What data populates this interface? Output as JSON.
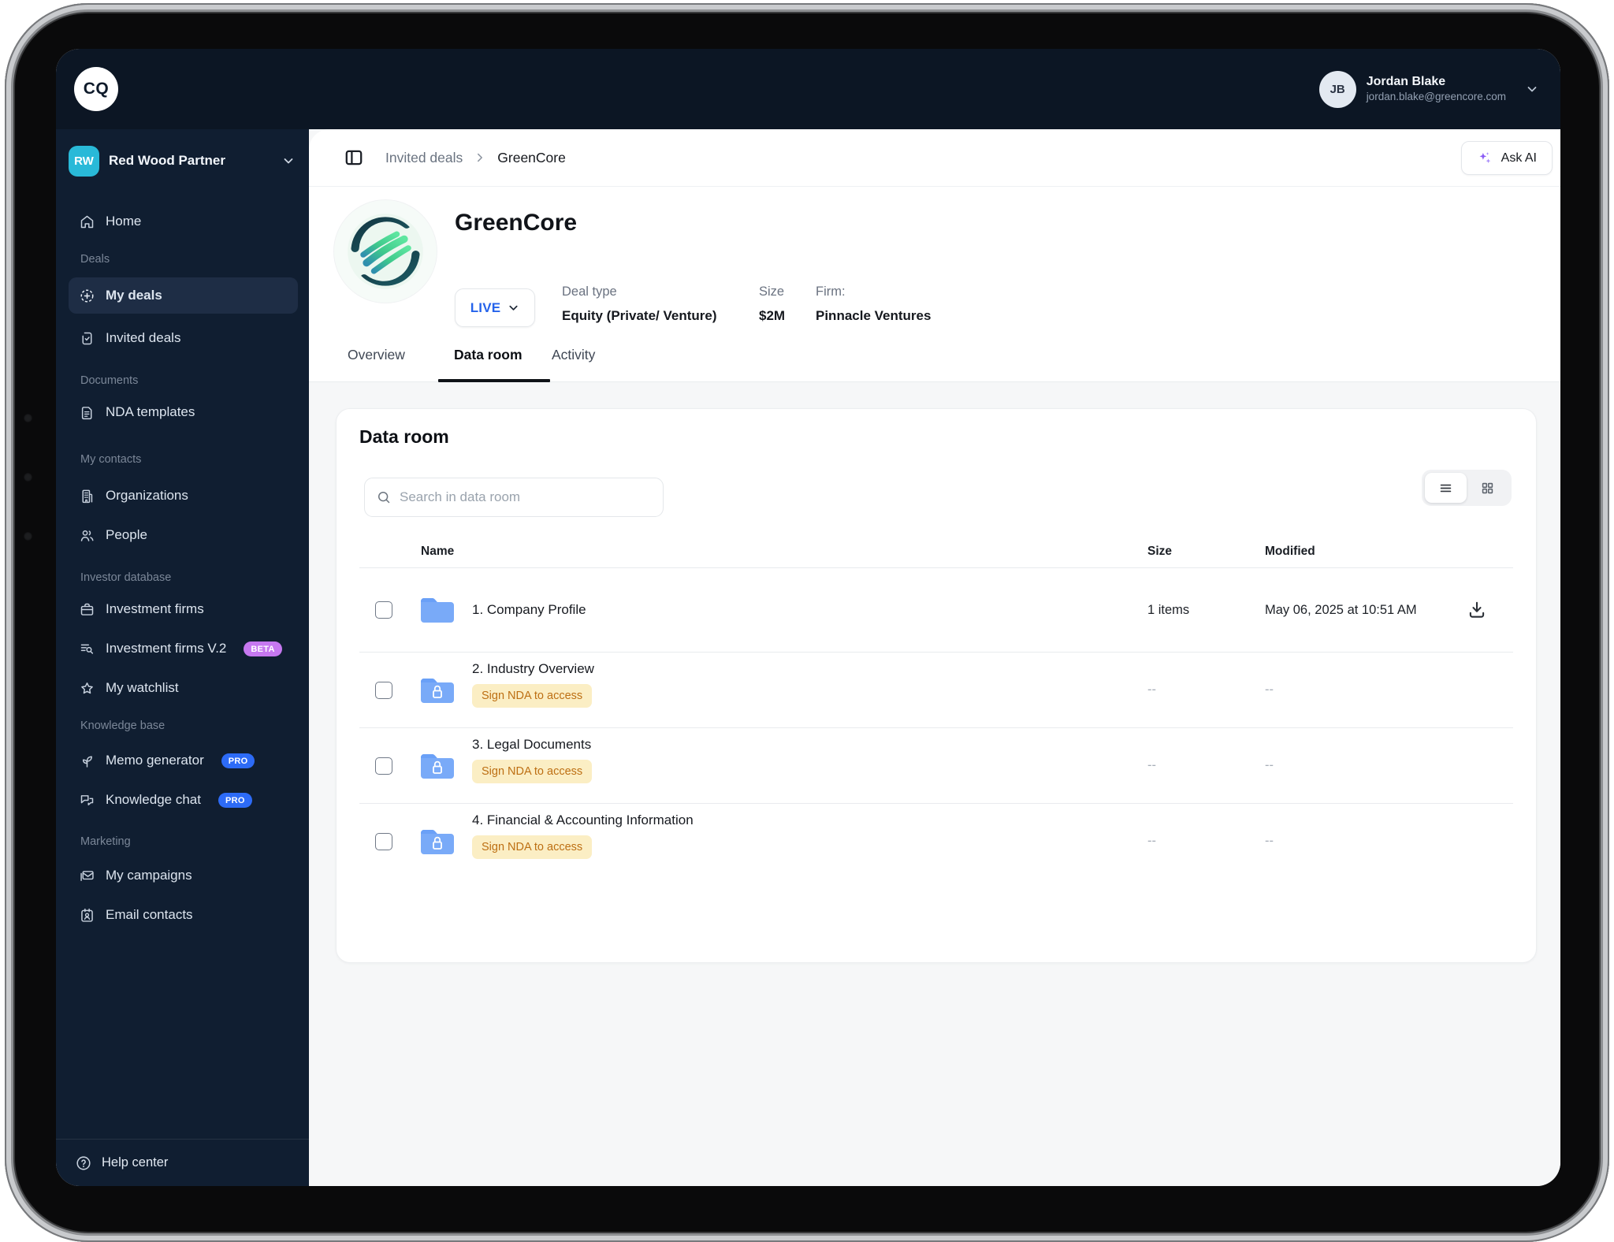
{
  "colors": {
    "topbar_bg": "#0c1624",
    "sidebar_bg": "#101e31",
    "workspace_badge": "#29b9d8",
    "beta_badge": "#c678f0",
    "pro_badge": "#2d6bf6",
    "live_blue": "#2563eb",
    "ai_sparkle": "#8b5cf6",
    "folder_blue": "#79aaf8",
    "nda_badge_bg": "#fbeec4",
    "nda_badge_text": "#bd6f13"
  },
  "topbar": {
    "logo_text": "CQ",
    "user": {
      "initials": "JB",
      "name": "Jordan Blake",
      "email": "jordan.blake@greencore.com"
    }
  },
  "sidebar": {
    "workspace": {
      "initials": "RW",
      "name": "Red Wood Partner"
    },
    "home_label": "Home",
    "sections": [
      {
        "label": "Deals",
        "items": [
          {
            "label": "My deals"
          },
          {
            "label": "Invited deals"
          }
        ]
      },
      {
        "label": "Documents",
        "items": [
          {
            "label": "NDA templates"
          }
        ]
      },
      {
        "label": "My contacts",
        "items": [
          {
            "label": "Organizations"
          },
          {
            "label": "People"
          }
        ]
      },
      {
        "label": "Investor database",
        "items": [
          {
            "label": "Investment firms"
          },
          {
            "label": "Investment firms V.2",
            "badge": "BETA"
          },
          {
            "label": "My watchlist"
          }
        ]
      },
      {
        "label": "Knowledge base",
        "items": [
          {
            "label": "Memo generator",
            "badge": "PRO"
          },
          {
            "label": "Knowledge chat",
            "badge": "PRO"
          }
        ]
      },
      {
        "label": "Marketing",
        "items": [
          {
            "label": "My campaigns"
          },
          {
            "label": "Email contacts"
          }
        ]
      }
    ],
    "help_label": "Help center"
  },
  "breadcrumb": {
    "parent": "Invited deals",
    "current": "GreenCore"
  },
  "actions": {
    "ask_ai_label": "Ask AI"
  },
  "deal": {
    "name": "GreenCore",
    "status_label": "LIVE",
    "fields": [
      {
        "label": "Deal type",
        "value": "Equity (Private/ Venture)"
      },
      {
        "label": "Size",
        "value": "$2M"
      },
      {
        "label": "Firm:",
        "value": "Pinnacle Ventures"
      }
    ]
  },
  "tabs": [
    {
      "label": "Overview"
    },
    {
      "label": "Data room"
    },
    {
      "label": "Activity"
    }
  ],
  "dataroom": {
    "title": "Data room",
    "search_placeholder": "Search in data room",
    "columns": {
      "name": "Name",
      "size": "Size",
      "modified": "Modified"
    },
    "rows": [
      {
        "name": "1. Company Profile",
        "size": "1 items",
        "modified": "May 06, 2025 at 10:51 AM"
      },
      {
        "name": "2. Industry Overview",
        "badge": "Sign NDA to access",
        "size": "--",
        "modified": "--"
      },
      {
        "name": "3. Legal Documents",
        "badge": "Sign NDA to access",
        "size": "--",
        "modified": "--"
      },
      {
        "name": "4. Financial & Accounting Information",
        "badge": "Sign NDA to access",
        "size": "--",
        "modified": "--"
      }
    ]
  }
}
